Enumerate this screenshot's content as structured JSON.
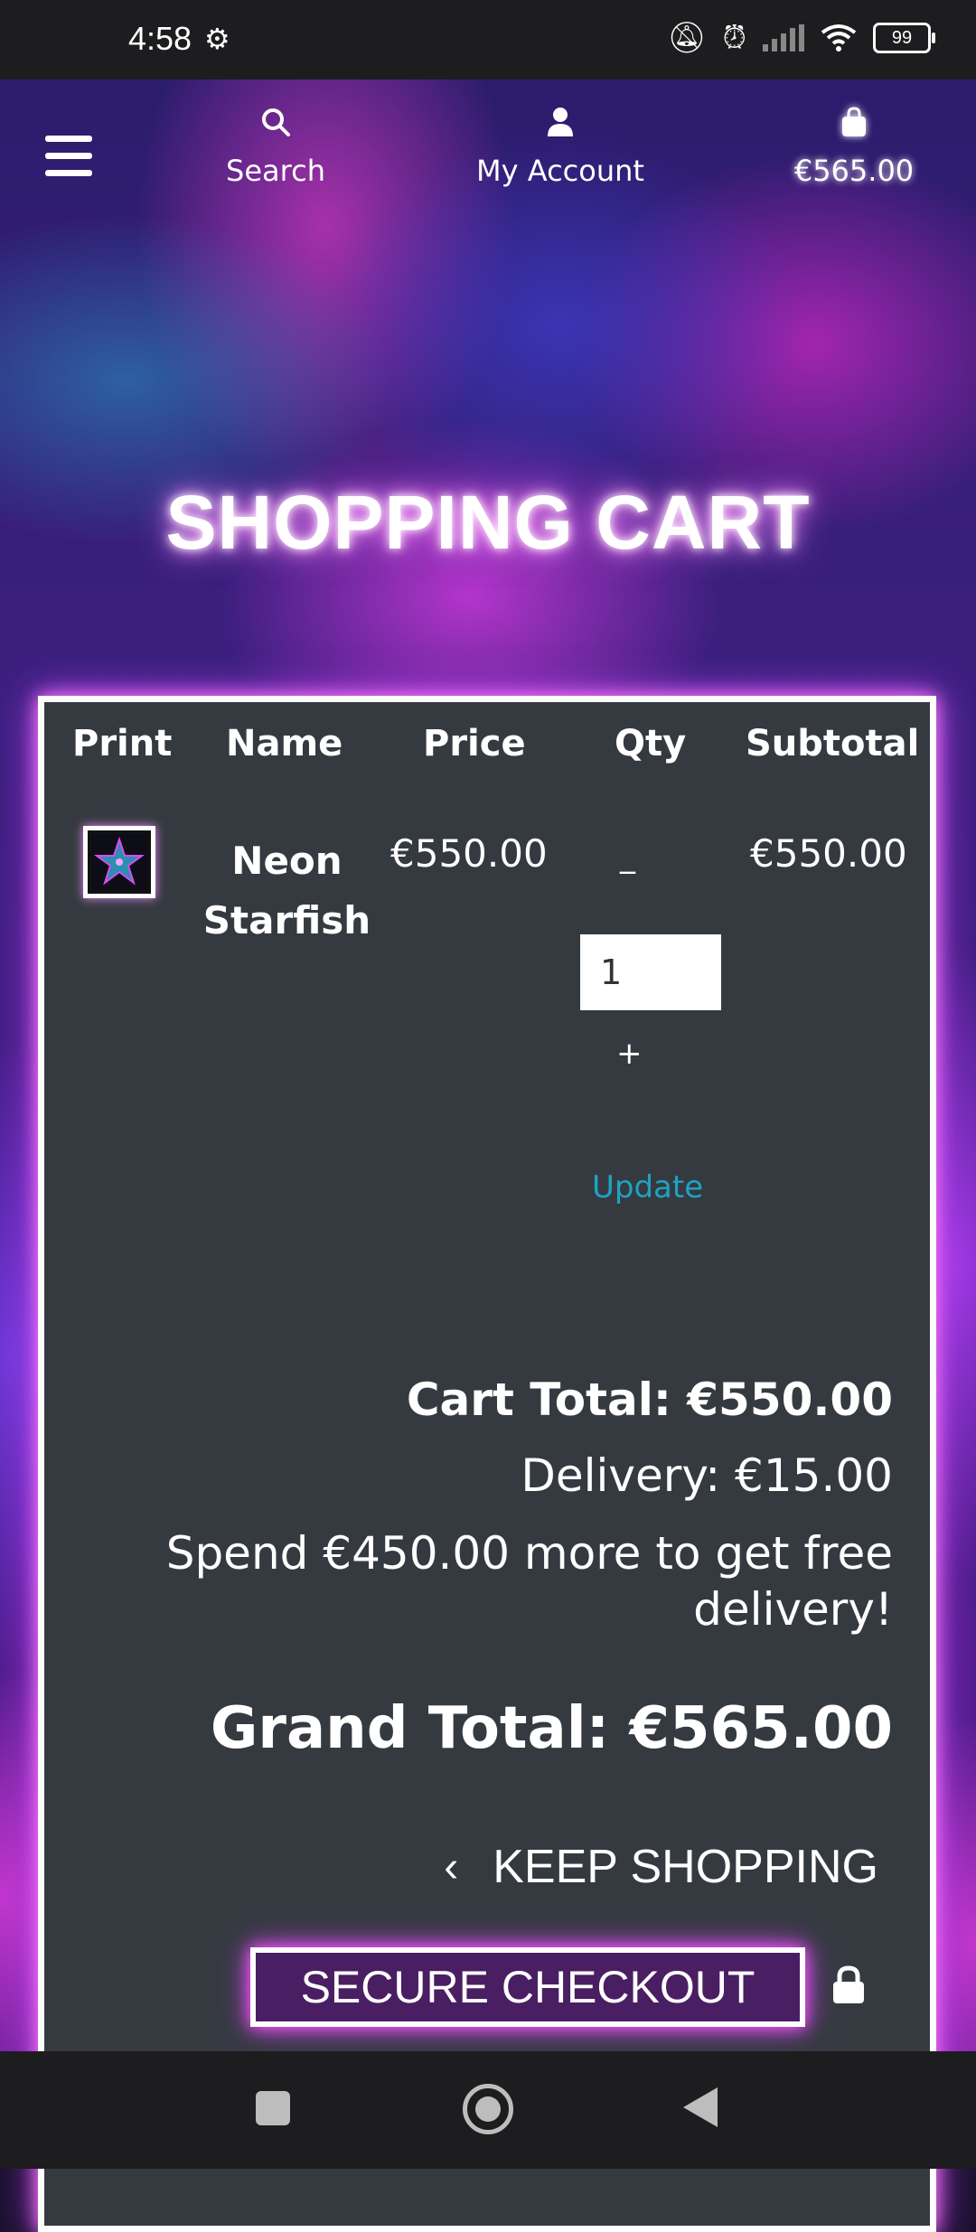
{
  "status_bar": {
    "time": "4:58",
    "battery": "99",
    "icons": [
      "gear-icon",
      "bell-off-icon",
      "alarm-icon",
      "signal-icon",
      "wifi-icon",
      "battery-icon"
    ]
  },
  "header": {
    "search_label": "Search",
    "account_label": "My Account",
    "cart_total": "€565.00"
  },
  "page_title": "SHOPPING CART",
  "table": {
    "headers": [
      "Print",
      "Name",
      "Price",
      "Qty",
      "Subtotal"
    ],
    "rows": [
      {
        "name_line1": "Neon",
        "name_line2": "Starfish",
        "price": "€550.00",
        "qty": "1",
        "subtotal": "€550.00",
        "minus": "_",
        "plus": "+",
        "update": "Update"
      }
    ]
  },
  "summary": {
    "cart_total": "Cart Total: €550.00",
    "delivery": "Delivery: €15.00",
    "spend_more": "Spend €450.00 more to get free delivery!",
    "grand_total": "Grand Total: €565.00"
  },
  "actions": {
    "keep_shopping": "KEEP SHOPPING",
    "secure_checkout": "SECURE CHECKOUT"
  },
  "colors": {
    "accent_glow": "#e878ff",
    "panel_bg": "#353a40",
    "link": "#1fa2c2"
  }
}
